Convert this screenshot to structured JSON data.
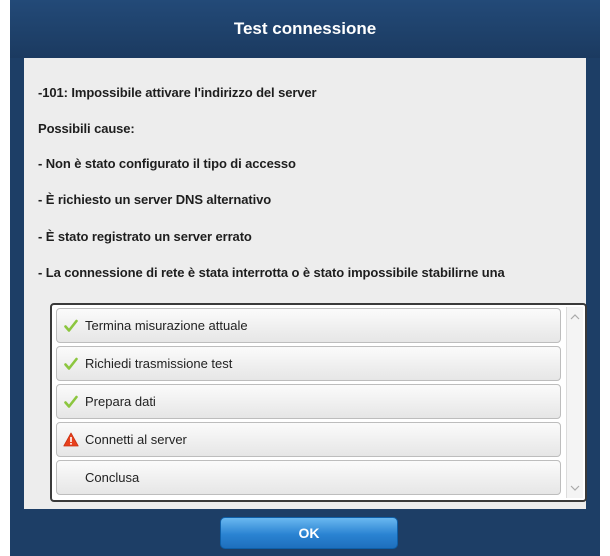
{
  "dialog": {
    "title": "Test connessione",
    "error_line": "-101: Impossibile attivare l'indirizzo del server",
    "causes_heading": "Possibili cause:",
    "causes": [
      "- Non è stato configurato il tipo di accesso",
      "- È richiesto un server DNS alternativo",
      "- È stato registrato un server errato",
      "- La connessione di rete è stata interrotta o è stato impossibile stabilirne una"
    ],
    "steps": [
      {
        "label": "Termina misurazione attuale",
        "status": "done",
        "icon": "checkmark-icon"
      },
      {
        "label": "Richiedi trasmissione test",
        "status": "done",
        "icon": "checkmark-icon"
      },
      {
        "label": "Prepara dati",
        "status": "done",
        "icon": "checkmark-icon"
      },
      {
        "label": "Connetti al server",
        "status": "error",
        "icon": "warning-icon"
      },
      {
        "label": "Conclusa",
        "status": "pending",
        "icon": ""
      }
    ],
    "ok_label": "OK"
  },
  "colors": {
    "titlebar": "#1d3e66",
    "check": "#8cc63f",
    "warning": "#e8401c",
    "ok_button": "#2a83d2"
  }
}
